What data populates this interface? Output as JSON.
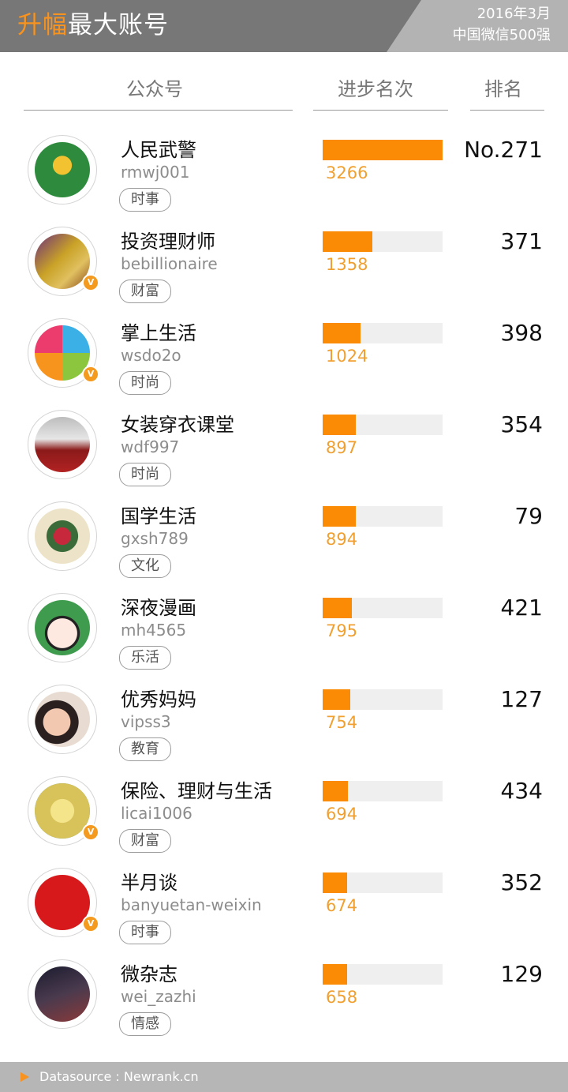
{
  "header": {
    "title_highlight": "升幅",
    "title_rest": "最大账号",
    "date": "2016年3月",
    "subtitle": "中国微信500强"
  },
  "columns": {
    "account": "公众号",
    "progress": "进步名次",
    "rank": "排名"
  },
  "bar_max": 3266,
  "accounts": [
    {
      "name": "人民武警",
      "handle": "rmwj001",
      "tag": "时事",
      "progress": 3266,
      "progress_label": "3266",
      "rank": "No.271",
      "verified": false,
      "avatar_icon": "armed-police-emblem-icon",
      "avatar_color": "#2e8b3e"
    },
    {
      "name": "投资理财师",
      "handle": "bebillionaire",
      "tag": "财富",
      "progress": 1358,
      "progress_label": "1358",
      "rank": "371",
      "verified": true,
      "avatar_icon": "money-coins-icon",
      "avatar_color": "#c9a227"
    },
    {
      "name": "掌上生活",
      "handle": "wsdo2o",
      "tag": "时尚",
      "progress": 1024,
      "progress_label": "1024",
      "rank": "398",
      "verified": true,
      "avatar_icon": "four-hearts-clover-icon",
      "avatar_color": "#ffffff"
    },
    {
      "name": "女装穿衣课堂",
      "handle": "wdf997",
      "tag": "时尚",
      "progress": 897,
      "progress_label": "897",
      "rank": "354",
      "verified": false,
      "avatar_icon": "fashion-woman-icon",
      "avatar_color": "#cfcfcf"
    },
    {
      "name": "国学生活",
      "handle": "gxsh789",
      "tag": "文化",
      "progress": 894,
      "progress_label": "894",
      "rank": "79",
      "verified": false,
      "avatar_icon": "peony-painting-icon",
      "avatar_color": "#ece3c8"
    },
    {
      "name": "深夜漫画",
      "handle": "mh4565",
      "tag": "乐活",
      "progress": 795,
      "progress_label": "795",
      "rank": "421",
      "verified": false,
      "avatar_icon": "cartoon-face-icon",
      "avatar_color": "#3f9c4e"
    },
    {
      "name": "优秀妈妈",
      "handle": "vipss3",
      "tag": "教育",
      "progress": 754,
      "progress_label": "754",
      "rank": "127",
      "verified": false,
      "avatar_icon": "mother-child-icon",
      "avatar_color": "#e8dcd2"
    },
    {
      "name": "保险、理财与生活",
      "handle": "licai1006",
      "tag": "财富",
      "progress": 694,
      "progress_label": "694",
      "rank": "434",
      "verified": true,
      "avatar_icon": "yuan-sign-icon",
      "avatar_color": "#d8c25a"
    },
    {
      "name": "半月谈",
      "handle": "banyuetan-weixin",
      "tag": "时事",
      "progress": 674,
      "progress_label": "674",
      "rank": "352",
      "verified": true,
      "avatar_icon": "banyuetan-logo-icon",
      "avatar_color": "#d7191c"
    },
    {
      "name": "微杂志",
      "handle": "wei_zazhi",
      "tag": "情感",
      "progress": 658,
      "progress_label": "658",
      "rank": "129",
      "verified": false,
      "avatar_icon": "night-city-photo-icon",
      "avatar_color": "#4a3a4e"
    }
  ],
  "footer": {
    "source": "Datasource : Newrank.cn"
  }
}
